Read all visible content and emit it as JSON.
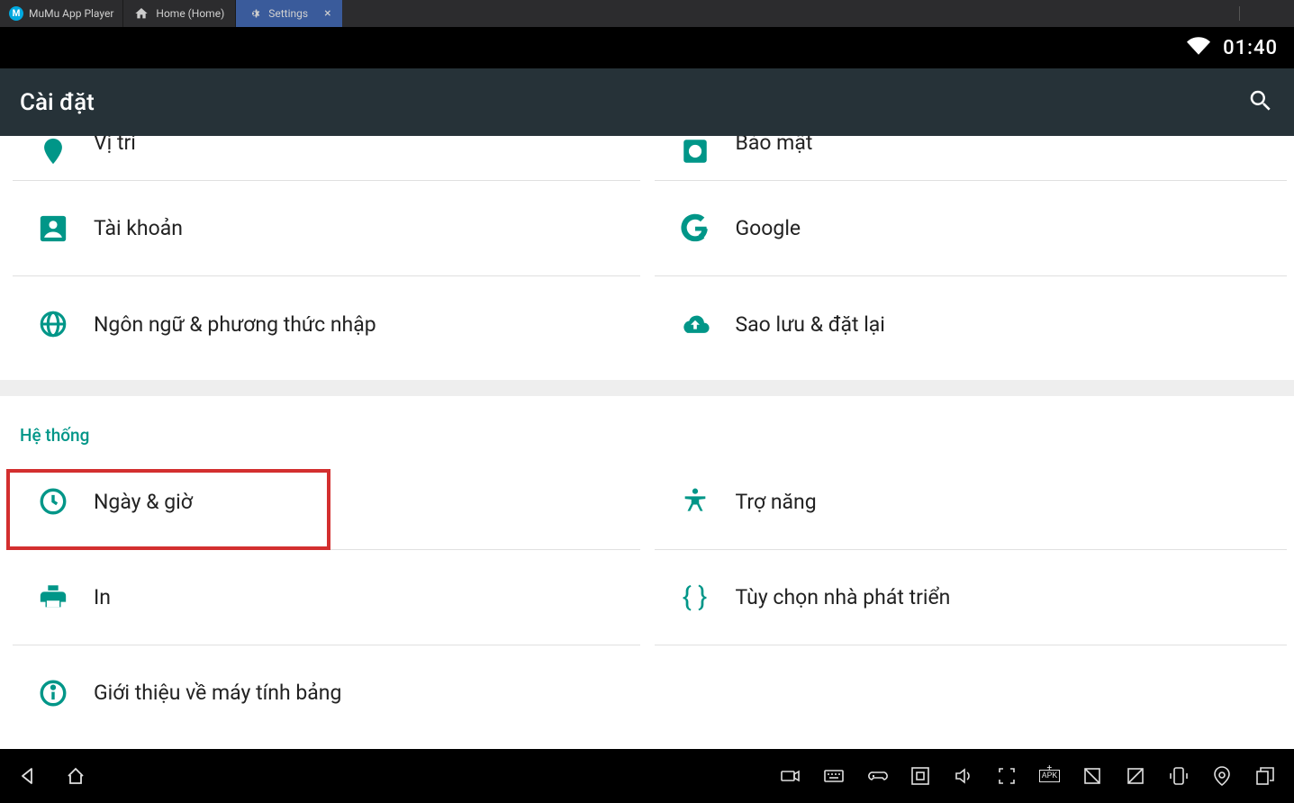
{
  "emulator": {
    "app_name": "MuMu App Player",
    "tabs": [
      {
        "label": "Home (Home)"
      },
      {
        "label": "Settings"
      }
    ]
  },
  "status": {
    "time": "01:40"
  },
  "appbar": {
    "title": "Cài đặt"
  },
  "rows": {
    "location": "Vị trí",
    "security": "Bảo mật",
    "accounts": "Tài khoản",
    "google": "Google",
    "language": "Ngôn ngữ & phương thức nhập",
    "backup": "Sao lưu & đặt lại"
  },
  "section": {
    "system": "Hệ thống"
  },
  "system_rows": {
    "datetime": "Ngày & giờ",
    "accessibility": "Trợ năng",
    "print": "In",
    "developer": "Tùy chọn nhà phát triển",
    "about": "Giới thiệu về máy tính bảng"
  },
  "colors": {
    "accent": "#009688",
    "highlight": "#d32f2f"
  }
}
